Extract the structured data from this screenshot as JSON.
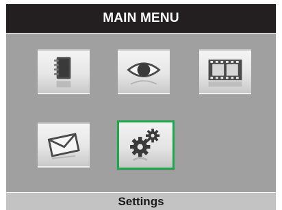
{
  "header": {
    "title": "MAIN MENU"
  },
  "menu": {
    "items": [
      {
        "icon": "notebook-icon"
      },
      {
        "icon": "eye-icon"
      },
      {
        "icon": "film-strip-icon"
      },
      {
        "icon": "envelope-icon"
      },
      {
        "icon": "gears-icon",
        "selected": true
      }
    ]
  },
  "status": {
    "label": "Settings"
  },
  "colors": {
    "title_bar": "#231f20",
    "panel": "#a0a0a0",
    "selection": "#1fa64b",
    "status_bar": "#c3c3c3"
  }
}
